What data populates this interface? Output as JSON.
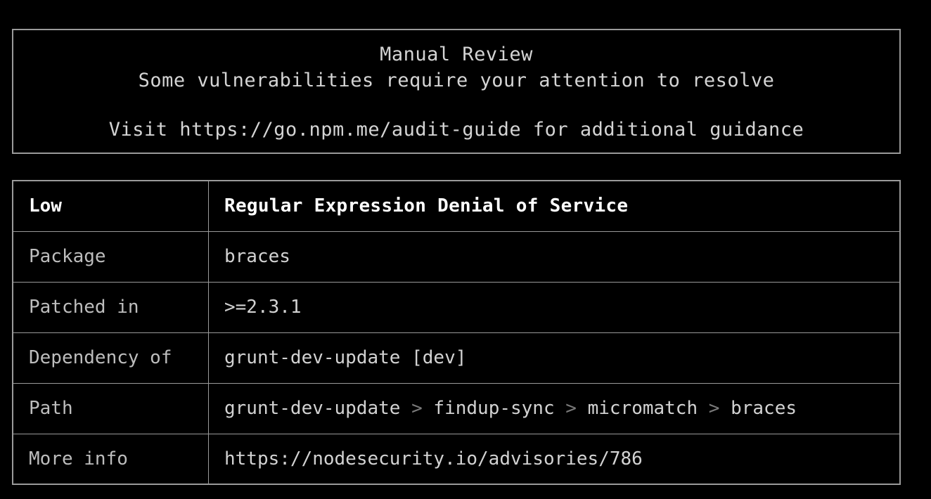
{
  "banner": {
    "title": "Manual Review",
    "subtitle": "Some vulnerabilities require your attention to resolve",
    "guide": "Visit https://go.npm.me/audit-guide for additional guidance"
  },
  "advisory": {
    "severity_label": "Low",
    "title": "Regular Expression Denial of Service",
    "rows": [
      {
        "label": "Package",
        "value": "braces"
      },
      {
        "label": "Patched in",
        "value": ">=2.3.1"
      },
      {
        "label": "Dependency of",
        "value": "grunt-dev-update [dev]"
      },
      {
        "label": "More info",
        "value": "https://nodesecurity.io/advisories/786"
      }
    ],
    "path": {
      "label": "Path",
      "separator": ">",
      "segments": [
        "grunt-dev-update",
        "findup-sync",
        "micromatch",
        "braces"
      ],
      "value": "grunt-dev-update > findup-sync > micromatch > braces"
    }
  },
  "colors": {
    "background": "#000000",
    "border": "#9a9a9a",
    "text": "#d2d2d2",
    "label_text": "#bdbdbd",
    "highlight_text": "#ffffff",
    "dim_text": "#7a7a7a"
  }
}
